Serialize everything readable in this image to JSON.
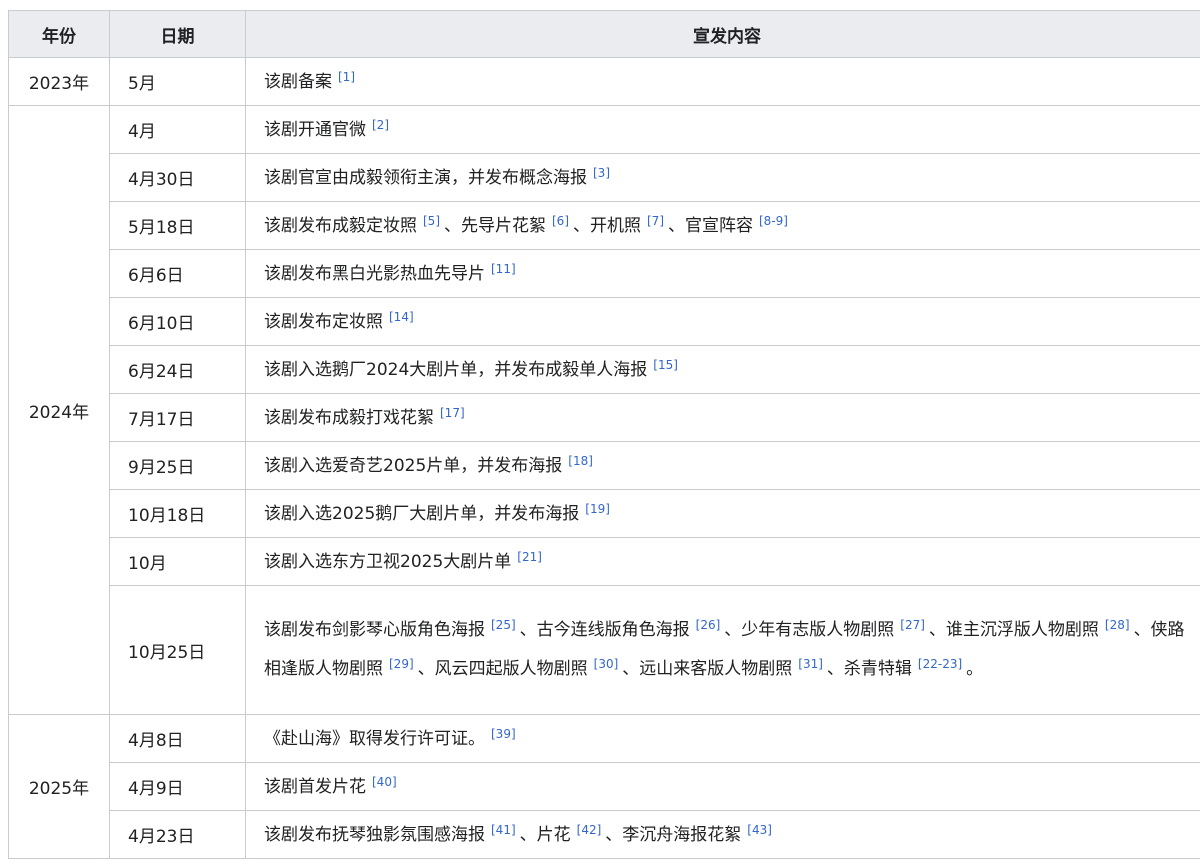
{
  "headers": {
    "year": "年份",
    "date": "日期",
    "content": "宣发内容"
  },
  "years": [
    "2023年",
    "2024年",
    "2025年"
  ],
  "rows": [
    {
      "date": "5月",
      "segments": [
        {
          "t": "该剧备案"
        },
        {
          "r": "[1]"
        }
      ]
    },
    {
      "date": "4月",
      "segments": [
        {
          "t": "该剧开通官微"
        },
        {
          "r": "[2]"
        }
      ]
    },
    {
      "date": "4月30日",
      "segments": [
        {
          "t": "该剧官宣由成毅领衔主演，并发布概念海报"
        },
        {
          "r": "[3]"
        }
      ]
    },
    {
      "date": "5月18日",
      "segments": [
        {
          "t": "该剧发布成毅定妆照"
        },
        {
          "r": "[5]"
        },
        {
          "t": "、先导片花絮"
        },
        {
          "r": "[6]"
        },
        {
          "t": "、开机照"
        },
        {
          "r": "[7]"
        },
        {
          "t": "、官宣阵容"
        },
        {
          "r": "[8-9]"
        }
      ]
    },
    {
      "date": "6月6日",
      "segments": [
        {
          "t": "该剧发布黑白光影热血先导片"
        },
        {
          "r": "[11]"
        }
      ]
    },
    {
      "date": "6月10日",
      "segments": [
        {
          "t": "该剧发布定妆照"
        },
        {
          "r": "[14]"
        }
      ]
    },
    {
      "date": "6月24日",
      "segments": [
        {
          "t": "该剧入选鹅厂2024大剧片单，并发布成毅单人海报"
        },
        {
          "r": "[15]"
        }
      ]
    },
    {
      "date": "7月17日",
      "segments": [
        {
          "t": "该剧发布成毅打戏花絮"
        },
        {
          "r": "[17]"
        }
      ]
    },
    {
      "date": "9月25日",
      "segments": [
        {
          "t": "该剧入选爱奇艺2025片单，并发布海报"
        },
        {
          "r": "[18]"
        }
      ]
    },
    {
      "date": "10月18日",
      "segments": [
        {
          "t": "该剧入选2025鹅厂大剧片单，并发布海报"
        },
        {
          "r": "[19]"
        }
      ]
    },
    {
      "date": "10月",
      "segments": [
        {
          "t": "该剧入选东方卫视2025大剧片单"
        },
        {
          "r": "[21]"
        }
      ]
    },
    {
      "date": "10月25日",
      "segments": [
        {
          "t": "该剧发布剑影琴心版角色海报"
        },
        {
          "r": "[25]"
        },
        {
          "t": "、古今连线版角色海报"
        },
        {
          "r": "[26]"
        },
        {
          "t": "、少年有志版人物剧照"
        },
        {
          "r": "[27]"
        },
        {
          "t": "、谁主沉浮版人物剧照"
        },
        {
          "r": "[28]"
        },
        {
          "t": "、侠路相逢版人物剧照"
        },
        {
          "r": "[29]"
        },
        {
          "t": "、风云四起版人物剧照"
        },
        {
          "r": "[30]"
        },
        {
          "t": "、远山来客版人物剧照"
        },
        {
          "r": "[31]"
        },
        {
          "t": "、杀青特辑"
        },
        {
          "r": "[22-23]"
        },
        {
          "t": "。"
        }
      ]
    },
    {
      "date": "4月8日",
      "segments": [
        {
          "t": "《赴山海》取得发行许可证。"
        },
        {
          "r": "[39]"
        }
      ]
    },
    {
      "date": "4月9日",
      "segments": [
        {
          "t": "该剧首发片花"
        },
        {
          "r": "[40]"
        }
      ]
    },
    {
      "date": "4月23日",
      "segments": [
        {
          "t": "该剧发布抚琴独影氛围感海报"
        },
        {
          "r": "[41]"
        },
        {
          "t": "、片花"
        },
        {
          "r": "[42]"
        },
        {
          "t": "、李沉舟海报花絮"
        },
        {
          "r": "[43]"
        }
      ]
    }
  ]
}
